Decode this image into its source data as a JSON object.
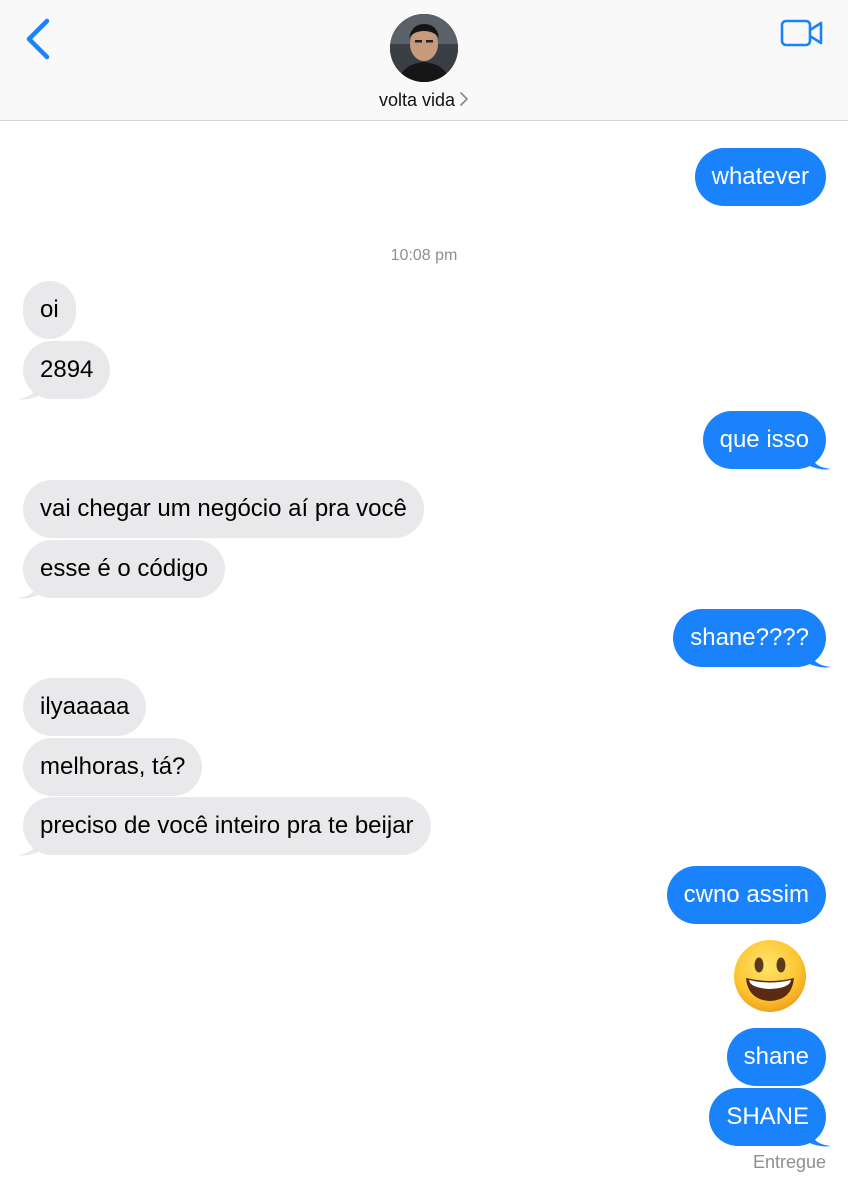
{
  "header": {
    "contact_name": "volta vida"
  },
  "thread": {
    "timestamp": "10:08 pm",
    "messages": [
      {
        "dir": "out",
        "text": "whatever"
      },
      {
        "dir": "in",
        "text": "oi"
      },
      {
        "dir": "in",
        "text": "2894"
      },
      {
        "dir": "out",
        "text": "que isso"
      },
      {
        "dir": "in",
        "text": "vai chegar um negócio aí pra você"
      },
      {
        "dir": "in",
        "text": "esse é o código"
      },
      {
        "dir": "out",
        "text": "shane????"
      },
      {
        "dir": "in",
        "text": "ilyaaaaa"
      },
      {
        "dir": "in",
        "text": "melhoras, tá?"
      },
      {
        "dir": "in",
        "text": "preciso de você inteiro pra te beijar"
      },
      {
        "dir": "out",
        "text": "cwno assim"
      },
      {
        "dir": "out",
        "emoji": "grinning-face"
      },
      {
        "dir": "out",
        "text": "shane"
      },
      {
        "dir": "out",
        "text": "SHANE"
      }
    ],
    "delivery_status": "Entregue"
  },
  "colors": {
    "accent": "#1a82fb",
    "incoming_bubble": "#e9e9eb",
    "header_bg": "#f9f9f9"
  }
}
